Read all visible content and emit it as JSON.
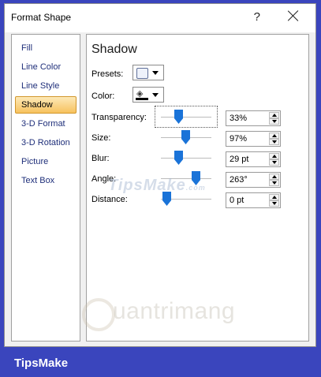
{
  "window": {
    "title": "Format Shape",
    "help_label": "?"
  },
  "sidebar": {
    "items": [
      {
        "label": "Fill"
      },
      {
        "label": "Line Color"
      },
      {
        "label": "Line Style"
      },
      {
        "label": "Shadow",
        "selected": true
      },
      {
        "label": "3-D Format"
      },
      {
        "label": "3-D Rotation"
      },
      {
        "label": "Picture"
      },
      {
        "label": "Text Box"
      }
    ]
  },
  "shadow": {
    "heading": "Shadow",
    "presets_label": "Presets:",
    "color_label": "Color:",
    "transparency": {
      "label": "Transparency:",
      "value": "33%"
    },
    "size": {
      "label": "Size:",
      "value": "97%"
    },
    "blur": {
      "label": "Blur:",
      "value": "29 pt"
    },
    "angle": {
      "label": "Angle:",
      "value": "263°"
    },
    "distance": {
      "label": "Distance:",
      "value": "0 pt"
    }
  },
  "watermarks": {
    "tipsmake": "TipsMake",
    "tipsmake_suffix": ".com",
    "quantrimang": "uantrimang",
    "footer": "TipsMake"
  },
  "colors": {
    "accent": "#1a73d8",
    "selected_bg": "#f7c25e",
    "background": "#3a45bd"
  }
}
